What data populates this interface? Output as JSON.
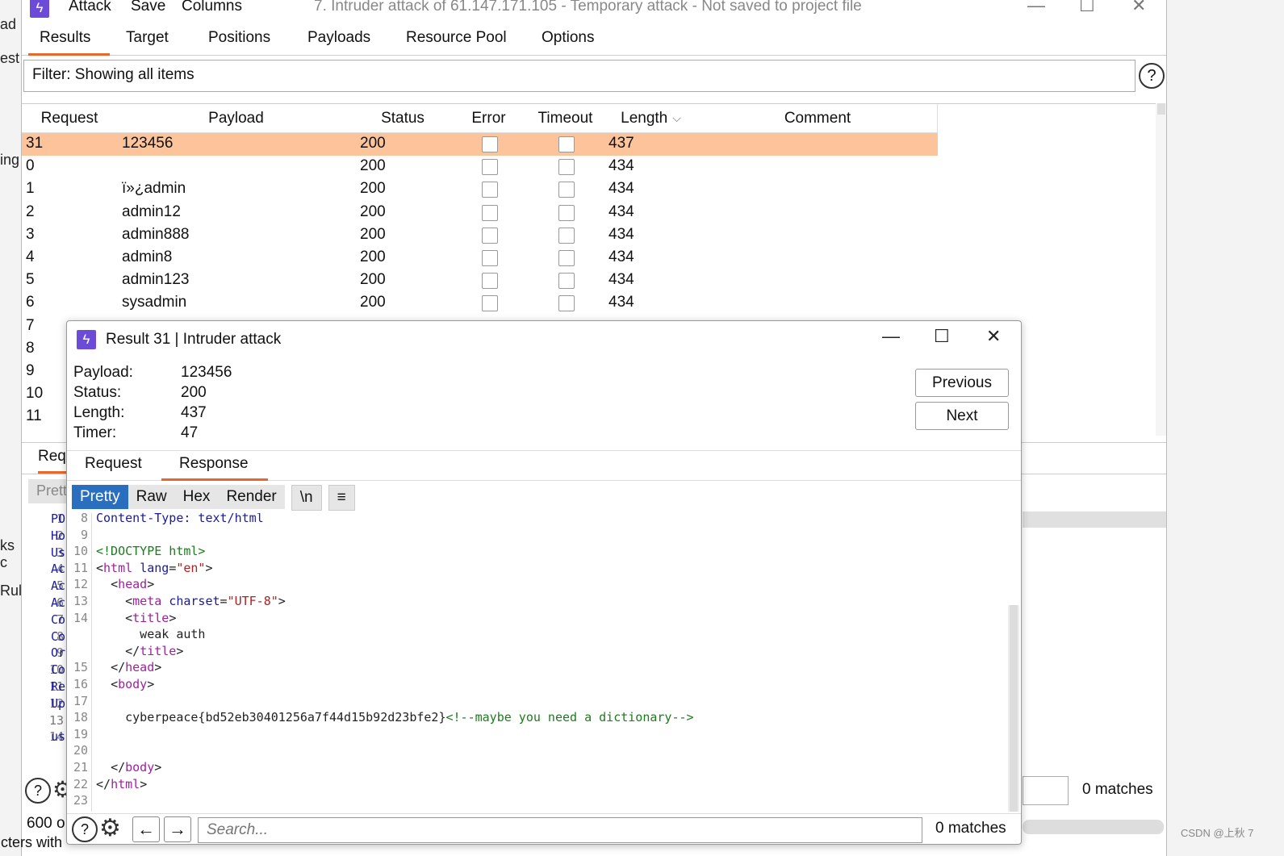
{
  "bg_left": {
    "items": [
      "ad",
      "est",
      "ing",
      "ks c",
      "Rule"
    ]
  },
  "window": {
    "menu": [
      "Attack",
      "Save",
      "Columns"
    ],
    "title": "7. Intruder attack of 61.147.171.105 - Temporary attack - Not saved to project file",
    "controls": {
      "minimize": "—",
      "maximize": "☐",
      "close": "✕"
    }
  },
  "tabs": [
    "Results",
    "Target",
    "Positions",
    "Payloads",
    "Resource Pool",
    "Options"
  ],
  "filter": {
    "text": "Filter: Showing all items",
    "help": "?"
  },
  "table": {
    "headers": [
      "Request",
      "Payload",
      "Status",
      "Error",
      "Timeout",
      "Length",
      "Comment"
    ],
    "sort_indicator": "⌵",
    "rows": [
      {
        "request": "31",
        "payload": "123456",
        "status": "200",
        "length": "437",
        "selected": true
      },
      {
        "request": "0",
        "payload": "",
        "status": "200",
        "length": "434"
      },
      {
        "request": "1",
        "payload": "ï»¿admin",
        "status": "200",
        "length": "434"
      },
      {
        "request": "2",
        "payload": "admin12",
        "status": "200",
        "length": "434"
      },
      {
        "request": "3",
        "payload": "admin888",
        "status": "200",
        "length": "434"
      },
      {
        "request": "4",
        "payload": "admin8",
        "status": "200",
        "length": "434"
      },
      {
        "request": "5",
        "payload": "admin123",
        "status": "200",
        "length": "434"
      },
      {
        "request": "6",
        "payload": "sysadmin",
        "status": "200",
        "length": "434"
      },
      {
        "request": "7",
        "payload": "",
        "status": "",
        "length": ""
      },
      {
        "request": "8",
        "payload": "",
        "status": "",
        "length": ""
      },
      {
        "request": "9",
        "payload": "",
        "status": "",
        "length": ""
      },
      {
        "request": "10",
        "payload": "",
        "status": "",
        "length": ""
      },
      {
        "request": "11",
        "payload": "",
        "status": "",
        "length": ""
      }
    ]
  },
  "lower_panel": {
    "tab": "Requ",
    "pretty": "Prett",
    "line_numbers": [
      "1",
      "2",
      "3",
      "4",
      "5",
      "6",
      "7",
      "8",
      "9",
      "10",
      "11",
      "12",
      "13",
      "14"
    ],
    "lines": [
      "PO",
      "Ho",
      "Us",
      "Ac",
      "Ac",
      "Ac",
      "Co",
      "Co",
      "Or",
      "Co",
      "Re",
      "Up",
      "",
      "us"
    ],
    "matches": "0 matches",
    "count": "600 o",
    "footer": "cters with"
  },
  "dialog": {
    "title": "Result 31 | Intruder attack",
    "controls": {
      "minimize": "—",
      "maximize": "☐",
      "close": "✕"
    },
    "info": [
      {
        "label": "Payload:",
        "value": "123456"
      },
      {
        "label": "Status:",
        "value": "200"
      },
      {
        "label": "Length:",
        "value": "437"
      },
      {
        "label": "Timer:",
        "value": "47"
      }
    ],
    "buttons": {
      "previous": "Previous",
      "next": "Next"
    },
    "tabs": [
      "Request",
      "Response"
    ],
    "view_buttons": [
      "Pretty",
      "Raw",
      "Hex",
      "Render",
      "\\n",
      "≡"
    ],
    "code": {
      "gutter": [
        "8",
        "9",
        "10",
        "11",
        "12",
        "13",
        "14",
        "",
        "",
        "15",
        "16",
        "17",
        "18",
        "19",
        "20",
        "21",
        "22",
        "23"
      ],
      "lines": [
        "Content-Type: text/html",
        "",
        "<!DOCTYPE html>",
        "<html lang=\"en\">",
        "  <head>",
        "    <meta charset=\"UTF-8\">",
        "    <title>",
        "      weak auth",
        "    </title>",
        "  </head>",
        "  <body>",
        "",
        "    cyberpeace{bd52eb30401256a7f44d15b92d23bfe2}<!--maybe you need a dictionary-->",
        "",
        "",
        "  </body>",
        "</html>",
        ""
      ]
    },
    "search_placeholder": "Search...",
    "matches": "0 matches"
  },
  "watermark": "CSDN @上秋 7"
}
